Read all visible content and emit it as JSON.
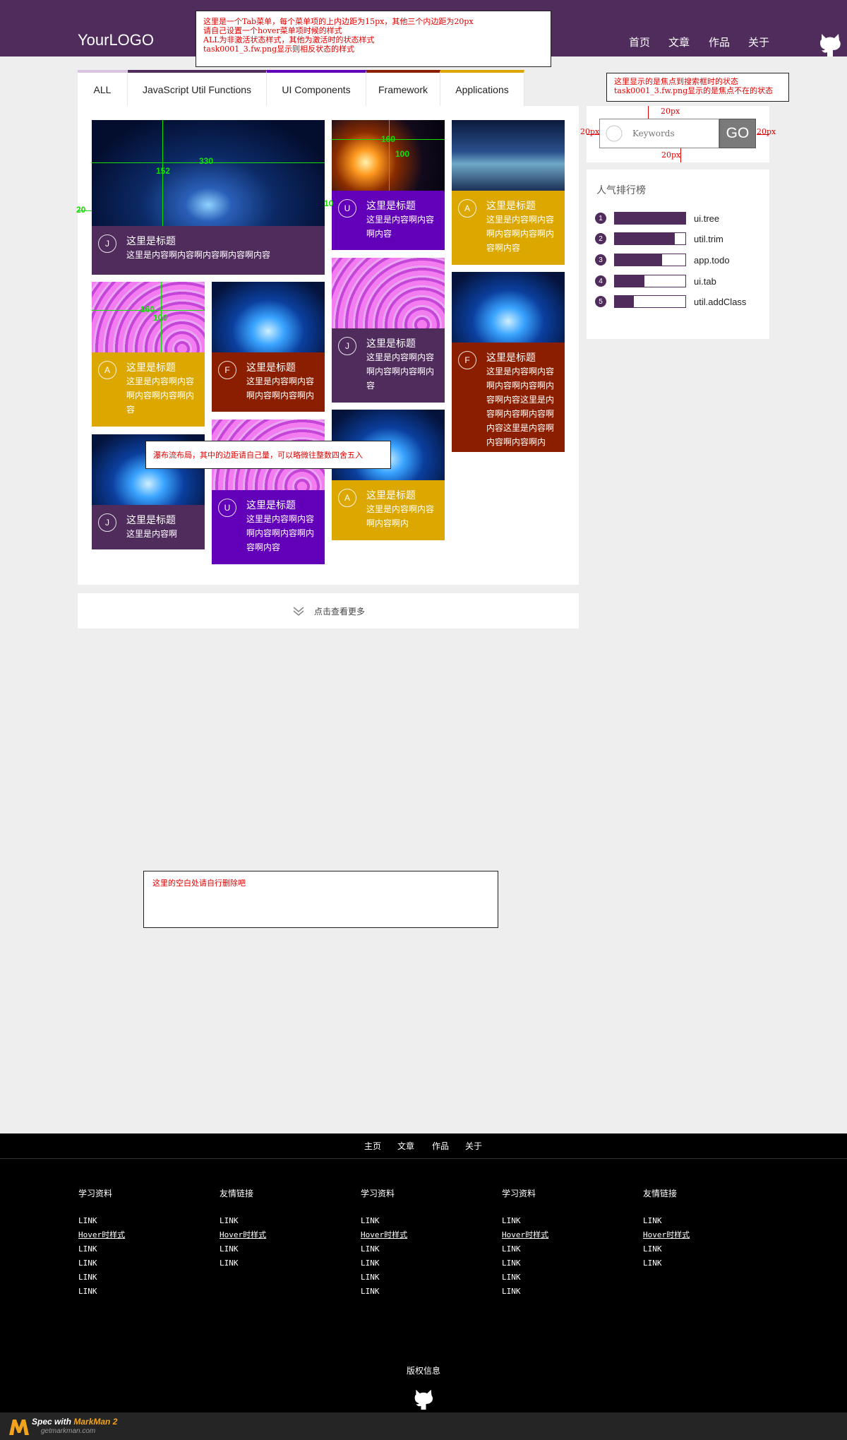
{
  "header": {
    "logo": "YourLOGO",
    "nav": [
      "首页",
      "文章",
      "作品",
      "关于"
    ]
  },
  "notes": {
    "tab": [
      "这里是一个Tab菜单，每个菜单项的上内边距为15px，其他三个内边距为20px",
      "请自己设置一个hover菜单项时候的样式",
      "ALL为非激活状态样式，其他为激活时的状态样式",
      "task0001_3.fw.png显示则相反状态的样式"
    ],
    "search": [
      "这里显示的是焦点到搜索框时的状态",
      "task0001_3.fw.png显示的是焦点不在的状态"
    ],
    "waterfall": "瀑布流布局，其中的边距请自己量，可以略微往整数四舍五入",
    "blank": "这里的空白处请自行删除吧"
  },
  "tabs": [
    "ALL",
    "JavaScript Util Functions",
    "UI Components",
    "Framework",
    "Applications"
  ],
  "colors": {
    "purple": "#4f2c5c",
    "yellow": "#dca800",
    "violet": "#6100b8",
    "red": "#8c1e00",
    "tab_all": "#d8c3e0",
    "tab_js": "#4f2c5c",
    "tab_ui": "#6100b8",
    "tab_fw": "#8c1e00",
    "tab_app": "#dca800"
  },
  "cards": [
    {
      "icon": "J",
      "title": "这里是标题",
      "desc": "这里是内容啊内容啊内容啊内容啊内容"
    },
    {
      "icon": "U",
      "title": "这里是标题",
      "desc": "这里是内容啊内容啊内容"
    },
    {
      "icon": "A",
      "title": "这里是标题",
      "desc": "这里是内容啊内容啊内容啊内容啊内容啊内容"
    },
    {
      "icon": "A",
      "title": "这里是标题",
      "desc": "这里是内容啊内容啊内容啊内容啊内容"
    },
    {
      "icon": "F",
      "title": "这里是标题",
      "desc": "这里是内容啊内容啊内容啊内容啊内"
    },
    {
      "icon": "J",
      "title": "这里是标题",
      "desc": "这里是内容啊内容啊内容啊内容啊内容"
    },
    {
      "icon": "F",
      "title": "这里是标题",
      "desc": "这里是内容啊内容啊内容啊内容啊内容啊内容这里是内容啊内容啊内容啊内容这里是内容啊内容啊内容啊内"
    },
    {
      "icon": "J",
      "title": "这里是标题",
      "desc": "这里是内容啊"
    },
    {
      "icon": "U",
      "title": "这里是标题",
      "desc": "这里是内容啊内容啊内容啊内容啊内容啊内容"
    },
    {
      "icon": "A",
      "title": "这里是标题",
      "desc": "这里是内容啊内容啊内容啊内"
    }
  ],
  "measures": {
    "m330": "330",
    "m152": "152",
    "m20": "20",
    "m160": "160",
    "m100": "100",
    "m10": "10",
    "px20": "20px"
  },
  "load_more": "点击查看更多",
  "search": {
    "placeholder": "Keywords",
    "button": "GO"
  },
  "ranking": {
    "title": "人气排行榜",
    "items": [
      {
        "rank": "1",
        "label": "ui.tree",
        "value": 1.0
      },
      {
        "rank": "2",
        "label": "util.trim",
        "value": 0.85
      },
      {
        "rank": "3",
        "label": "app.todo",
        "value": 0.67
      },
      {
        "rank": "4",
        "label": "ui.tab",
        "value": 0.42
      },
      {
        "rank": "5",
        "label": "util.addClass",
        "value": 0.27
      }
    ]
  },
  "footer": {
    "nav": [
      "主页",
      "文章",
      "作品",
      "关于"
    ],
    "columns": [
      {
        "title": "学习资料",
        "links": [
          "LINK",
          "Hover时样式",
          "LINK",
          "LINK",
          "LINK",
          "LINK"
        ]
      },
      {
        "title": "友情链接",
        "links": [
          "LINK",
          "Hover时样式",
          "LINK",
          "LINK"
        ]
      },
      {
        "title": "学习资料",
        "links": [
          "LINK",
          "Hover时样式",
          "LINK",
          "LINK",
          "LINK",
          "LINK"
        ]
      },
      {
        "title": "学习资料",
        "links": [
          "LINK",
          "Hover时样式",
          "LINK",
          "LINK",
          "LINK",
          "LINK"
        ]
      },
      {
        "title": "友情链接",
        "links": [
          "LINK",
          "Hover时样式",
          "LINK",
          "LINK"
        ]
      }
    ],
    "copyright": "版权信息"
  },
  "markman": {
    "spec": "Spec with",
    "brand": "MarkMan 2",
    "url": "getmarkman.com"
  }
}
